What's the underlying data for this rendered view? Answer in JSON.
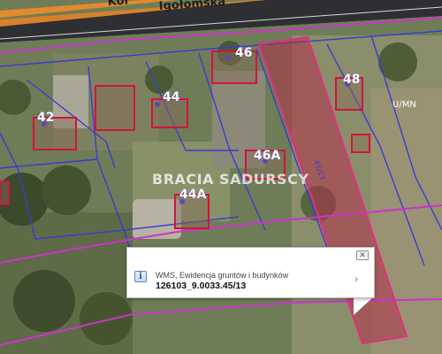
{
  "map": {
    "street_name": "Igołomska",
    "street_fragment": "Kor",
    "watermark": "BRACIA SADURSCY",
    "zone_label": "U/MN",
    "address_numbers": [
      "42",
      "44",
      "46",
      "48",
      "46A",
      "44A"
    ],
    "parcel_label": "45/13",
    "colors": {
      "road": "#d9812a",
      "parcel_fill": "#b0304a",
      "parcel_outline": "#e0307a",
      "building_outline": "#d2143c",
      "utility_line": "#cc33cc",
      "cadastral_line": "#3b3bd0"
    }
  },
  "popup": {
    "close_label": "✕",
    "info_icon": "info-icon",
    "layer_name": "WMS, Ewidencja gruntów i budynków",
    "parcel_id": "126103_9.0033.45/13",
    "next_label": "›"
  }
}
